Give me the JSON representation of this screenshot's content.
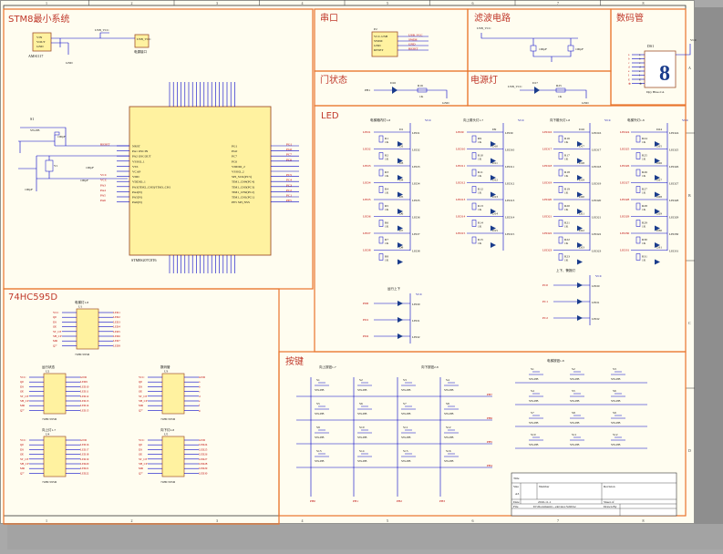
{
  "sections": {
    "stm8": "STM8最小系统",
    "uart": "串口",
    "filter": "滤波电路",
    "seg": "数码管",
    "gate": "门状态",
    "power_led": "电源灯",
    "led": "LED",
    "hc595": "74HC595D",
    "keys": "按键"
  },
  "ruler": {
    "cols": [
      "1",
      "2",
      "3",
      "4",
      "5",
      "6",
      "7",
      "8"
    ],
    "rows": [
      "A",
      "B",
      "C",
      "D"
    ]
  },
  "stm8_chip": {
    "name": "STM8S207C8T6",
    "left_pins": [
      "NRST",
      "PA1 OSCIN",
      "PA2 OSCOUT",
      "VSSIO_1",
      "VSS",
      "VCAP",
      "VDD",
      "VDDIO_1",
      "PA3(TIM2_CH3)/TIM3_CH1",
      "PA4(N)",
      "PA5(N)",
      "PA6(N)"
    ],
    "right_pins": [
      "PG1",
      "PG0",
      "PC7",
      "PC6",
      "VDDIO_2",
      "VSSIO_2",
      "SPI_SCK(PC5)",
      "TIM1_CH4(PC4)",
      "TIM1_CH3(PC3)",
      "TIM1_CH2(PC2)",
      "TIM1_CH1(PC1)",
      "PE5 SPI_NSS"
    ],
    "right_nets": [
      "PG1",
      "PG0",
      "PC7",
      "PC6",
      "",
      "",
      "PC5",
      "PC4",
      "PC3",
      "PC2",
      "PC1",
      "PE5"
    ],
    "left_nets": [
      "RESET",
      "",
      "",
      "",
      "",
      "",
      "VCC",
      "VCC",
      "PA3",
      "PA4",
      "PA5",
      "PA6"
    ]
  },
  "stm8_parts": {
    "reg": "AMS1117",
    "reg_pins": [
      "VIN",
      "VOUT",
      "GND"
    ],
    "usb": "USB_VCC",
    "usb_label": "电源接口",
    "btn": "SW-PB",
    "s1": "S1",
    "gnd": "GND",
    "caps": [
      "100pF",
      "100pF",
      "100pF",
      "100pF"
    ],
    "xtal": "Y1"
  },
  "uart_block": {
    "part": "P2",
    "pins": [
      "VCC-USB",
      "SWIM",
      "GND",
      "RESET"
    ],
    "nets": [
      "USB_VCC",
      "SWIM",
      "GND",
      "RESET"
    ]
  },
  "filter_block": {
    "net": "USB_VCC",
    "caps": [
      "100pF",
      "100pF"
    ]
  },
  "seg_block": {
    "part": "DS1",
    "digit": "8",
    "type": "Dpy Blue-CA",
    "net": "VCC",
    "pins": [
      "a",
      "b",
      "c",
      "d",
      "e",
      "f",
      "g",
      "dp"
    ]
  },
  "gate_block": {
    "net": "PB1",
    "led": "D16",
    "res": "R16",
    "val": "1K",
    "gnd": "GND"
  },
  "power_block": {
    "net": "USB_VCC",
    "led": "D17",
    "res": "R25",
    "val": "1K",
    "gnd": "GND"
  },
  "led_groups": [
    {
      "title": "电梯厢内灯1-8",
      "prefix": "LED",
      "start": 1
    },
    {
      "title": "向上箭头灯1-7",
      "prefix": "LED",
      "start": 9
    },
    {
      "title": "向下箭头灯1-8",
      "prefix": "LED",
      "start": 16
    },
    {
      "title": "电梯外灯1-8",
      "prefix": "LED",
      "start": 24
    }
  ],
  "led_vcc": "VCC",
  "led_extra": [
    {
      "title": "运行上下",
      "net": "PD"
    },
    {
      "title": "上下、警报灯",
      "net": "PC"
    }
  ],
  "hc595_groups": [
    {
      "title": "电梯灯1-8",
      "part": "U1",
      "pins": [
        "VCC",
        "Q0",
        "DS",
        "OE",
        "ST_CP",
        "SH_CP",
        "MR",
        "Q7'"
      ],
      "outs": [
        "LED1",
        "LED2",
        "LED3",
        "LED4",
        "LED5",
        "LED6",
        "LED7",
        "LED8"
      ]
    },
    {
      "title": "运行状态",
      "part": "U2",
      "pins": [
        "VCC",
        "Q0",
        "DS",
        "OE",
        "ST_CP",
        "SH_CP",
        "MR",
        "Q7'"
      ],
      "outs": [
        "GND",
        "LED9",
        "LED10",
        "LED11",
        "LED12",
        "LED13",
        "LED14",
        "LED15"
      ]
    },
    {
      "title": "数码管",
      "part": "U3",
      "pins": [
        "VCC",
        "Q0",
        "DS",
        "OE",
        "ST_CP",
        "SH_CP",
        "MR",
        "Q7'"
      ],
      "outs": [
        "GND",
        "a",
        "b",
        "c",
        "d",
        "e",
        "f",
        "g"
      ]
    },
    {
      "title": "向上灯1-7",
      "part": "U4",
      "pins": [
        "VCC",
        "Q0",
        "DS",
        "OE",
        "ST_CP",
        "SH_CP",
        "MR",
        "Q7'"
      ],
      "outs": [
        "GND",
        "LED16",
        "LED17",
        "LED18",
        "LED19",
        "LED20",
        "LED21",
        "LED22"
      ]
    },
    {
      "title": "向下灯2-8",
      "part": "U5",
      "pins": [
        "VCC",
        "Q0",
        "DS",
        "OE",
        "ST_CP",
        "SH_CP",
        "MR",
        "Q7'"
      ],
      "outs": [
        "GND",
        "LED24",
        "LED25",
        "LED26",
        "LED27",
        "LED28",
        "LED29",
        "LED30"
      ]
    }
  ],
  "hc595_part": "74HC595D",
  "key_groups": [
    {
      "title": "向上按钮1-7"
    },
    {
      "title": "向下按钮2-8"
    },
    {
      "title": "电梯按钮1-8"
    }
  ],
  "key_label": "SW-PB",
  "key_nets": [
    "PB7",
    "PB6",
    "PB5",
    "PB4"
  ],
  "key_cols": [
    "PB0",
    "PB1",
    "PB2",
    "PB3"
  ],
  "title_block": {
    "title_label": "Title",
    "size_label": "Size",
    "size": "A3",
    "number_label": "Number",
    "revision_label": "Revision",
    "date_label": "Date",
    "date": "2016-11-1",
    "file_label": "File",
    "file": "D:\\Documents\\...elevator.SchDoc",
    "sheet_label": "Sheet of",
    "drawn_label": "Drawn By"
  }
}
